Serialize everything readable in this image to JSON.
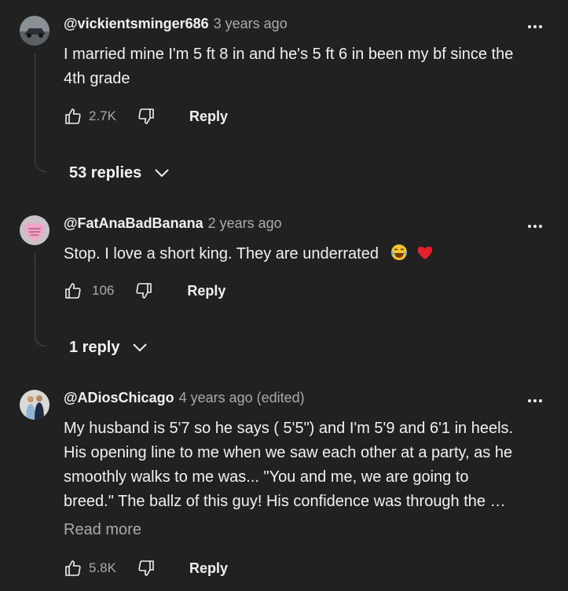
{
  "comments": [
    {
      "handle": "@vickientsminger686",
      "time": "3 years ago",
      "text_lines": [
        "I married mine I'm 5 ft 8 in and he's 5 ft 6 in been my bf since the",
        "4th grade"
      ],
      "likes": "2.7K",
      "reply_label": "Reply",
      "replies_label": "53 replies"
    },
    {
      "handle": "@FatAnaBadBanana",
      "time": "2 years ago",
      "text": "Stop. I love a short king. They are underrated",
      "likes": "106",
      "reply_label": "Reply",
      "replies_label": "1 reply"
    },
    {
      "handle": "@ADiosChicago",
      "time": "4 years ago (edited)",
      "text_lines": [
        "My husband is 5'7 so he says ( 5'5\") and I'm 5'9 and 6'1 in heels.",
        "His opening line to me when we saw each other at a party, as he",
        "smoothly walks to me was... \"You and me, we are going to",
        "breed.\" The ballz of this guy! His confidence was through the …"
      ],
      "read_more": "Read more",
      "likes": "5.8K",
      "reply_label": "Reply"
    }
  ],
  "icons": {
    "like": "thumbs-up-outline",
    "dislike": "thumbs-down-outline",
    "more": "vertical-more",
    "expand": "chevron-down"
  },
  "colors": {
    "background": "#212121",
    "text": "#f1f1f1",
    "secondary": "#aaaaaa"
  }
}
